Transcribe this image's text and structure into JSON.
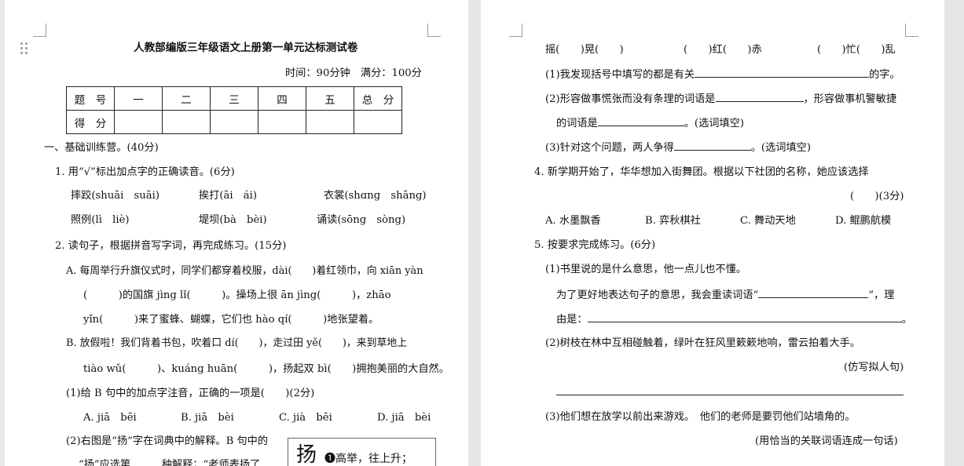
{
  "left": {
    "title": "人教部编版三年级语文上册第一单元达标测试卷",
    "time_info": "时间：90分钟　满分：100分",
    "score_table": {
      "headers": [
        "题　号",
        "一",
        "二",
        "三",
        "四",
        "五",
        "总　分"
      ],
      "row_label": "得　分"
    },
    "section1": "一、基础训练营。(40分)",
    "q1": "1. 用“√”标出加点字的正确读音。(6分)",
    "q1_items": [
      "摔跤(shuāi　suāi)",
      "挨打(āi　ái)",
      "衣裳(shɑng　shāng)",
      "照例(lì　liè)",
      "堤坝(bà　bèi)",
      "诵读(sōng　sòng)"
    ],
    "q2": "2. 读句子，根据拼音写字词，再完成练习。(15分)",
    "q2_a1": "A. 每周举行升旗仪式时，同学们都穿着校服，dài(　　)着红领巾，向 xiān yàn",
    "q2_a2": "(　　　)的国旗 jìng lǐ(　　　)。操场上很 ān jìng(　　　)，zhāo",
    "q2_a3": "yǐn(　　　)来了蜜蜂、蝴蝶，它们也 hào qí(　　　)地张望着。",
    "q2_b1": "B. 放假啦！我们背着书包，吹着口 dí(　　)，走过田 yě(　　)，来到草地上",
    "q2_b2": "tiào wǔ(　　　)、kuáng huān(　　　)，扬起双 bì(　　)拥抱美丽的大自然。",
    "q2_sub1": "(1)给 B 句中的加点字注音，正确的一项是(　　)(2分)",
    "q2_sub1_opts": [
      "A. jiā　bēi",
      "B. jiā　bèi",
      "C. jià　bēi",
      "D. jiā　bèi"
    ],
    "q2_sub2_a": "(2)右图是“扬”字在词典中的解释。B 句中的",
    "q2_sub2_b": "“扬”应选第　　　种解释；“老师表扬了",
    "dict_char": "扬",
    "dict_def": "❶高举，往上升；"
  },
  "right": {
    "line1": [
      "摇(　　)晃(　　)",
      "(　　)红(　　)赤",
      "(　　)忙(　　)乱"
    ],
    "s1": "(1)我发现括号中填写的都是有关",
    "s1_end": "的字。",
    "s2a": "(2)形容做事慌张而没有条理的词语是",
    "s2a_end": "，形容做事机警敏捷",
    "s2b": "的词语是",
    "s2b_end": "。(选词填空)",
    "s3": "(3)针对这个问题，两人争得",
    "s3_end": "。(选词填空)",
    "q4": "4. 新学期开始了，华华想加入街舞团。根据以下社团的名称，她应该选择",
    "q4_tail": "(　　)(3分)",
    "q4_opts": [
      "A. 水墨飘香",
      "B. 弈秋棋社",
      "C. 舞动天地",
      "D. 鲲鹏航模"
    ],
    "q5": "5. 按要求完成练习。(6分)",
    "q5_1": "(1)书里说的是什么意思，他一点儿也不懂。",
    "q5_1b": "为了更好地表达句子的意思，我会重读词语“",
    "q5_1b_end": "”，理",
    "q5_1c": "由是：",
    "q5_1c_end": "。",
    "q5_2": "(2)树枝在林中互相碰触着，绿叶在狂风里簌簌地响，雷云拍着大手。",
    "q5_2_tail": "(仿写拟人句)",
    "q5_3": "(3)他们想在放学以前出来游戏。　他们的老师是要罚他们站墙角的。",
    "q5_3_tail": "(用恰当的关联词语连成一句话)"
  }
}
